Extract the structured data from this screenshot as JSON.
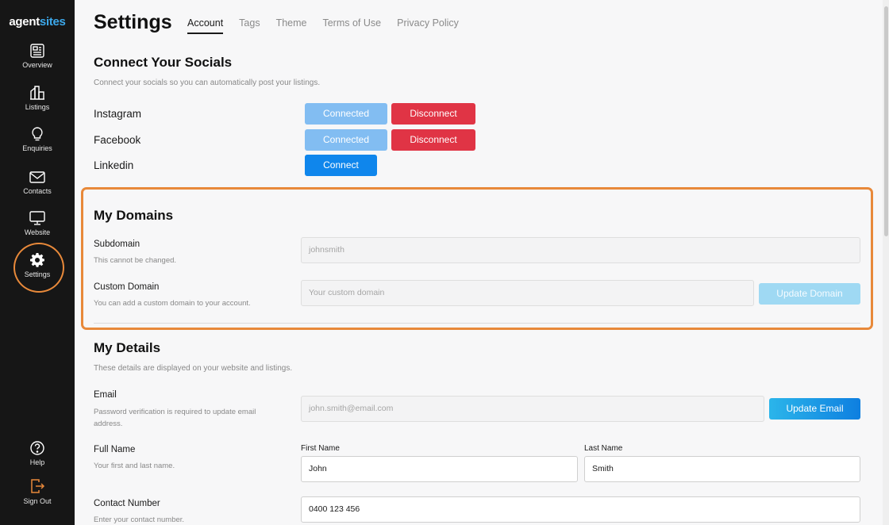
{
  "brand": {
    "part1": "agent",
    "part2": "sites"
  },
  "sidebar": {
    "items": [
      {
        "label": "Overview",
        "icon": "overview-icon"
      },
      {
        "label": "Listings",
        "icon": "listings-icon"
      },
      {
        "label": "Enquiries",
        "icon": "lightbulb-icon"
      },
      {
        "label": "Contacts",
        "icon": "envelope-icon"
      },
      {
        "label": "Website",
        "icon": "monitor-icon"
      },
      {
        "label": "Settings",
        "icon": "gear-icon"
      }
    ],
    "bottom": [
      {
        "label": "Help",
        "icon": "help-icon"
      },
      {
        "label": "Sign Out",
        "icon": "sign-out-icon"
      }
    ]
  },
  "page": {
    "title": "Settings"
  },
  "tabs": [
    "Account",
    "Tags",
    "Theme",
    "Terms of Use",
    "Privacy Policy"
  ],
  "socials": {
    "title": "Connect Your Socials",
    "description": "Connect your socials so you can automatically post your listings.",
    "rows": [
      {
        "name": "Instagram",
        "connected_label": "Connected",
        "disconnect_label": "Disconnect"
      },
      {
        "name": "Facebook",
        "connected_label": "Connected",
        "disconnect_label": "Disconnect"
      },
      {
        "name": "Linkedin",
        "connect_label": "Connect"
      }
    ]
  },
  "domains": {
    "title": "My Domains",
    "subdomain": {
      "label": "Subdomain",
      "help": "This cannot be changed.",
      "value": "johnsmith"
    },
    "custom": {
      "label": "Custom Domain",
      "help": "You can add a custom domain to your account.",
      "placeholder": "Your custom domain",
      "button": "Update Domain"
    }
  },
  "details": {
    "title": "My Details",
    "description": "These details are displayed on your website and listings.",
    "email": {
      "label": "Email",
      "help": "Password verification is required to update email address.",
      "value": "john.smith@email.com",
      "button": "Update Email"
    },
    "full_name": {
      "label": "Full Name",
      "help": "Your first and last name.",
      "first_label": "First Name",
      "first_value": "John",
      "last_label": "Last Name",
      "last_value": "Smith"
    },
    "contact": {
      "label": "Contact Number",
      "help": "Enter your contact number.",
      "value": "0400 123 456"
    }
  },
  "colors": {
    "accent_highlight": "#e8893a",
    "connected": "#82bdf2",
    "disconnect": "#e03445",
    "connect": "#0f86ec",
    "brand_blue": "#3da9ec"
  }
}
